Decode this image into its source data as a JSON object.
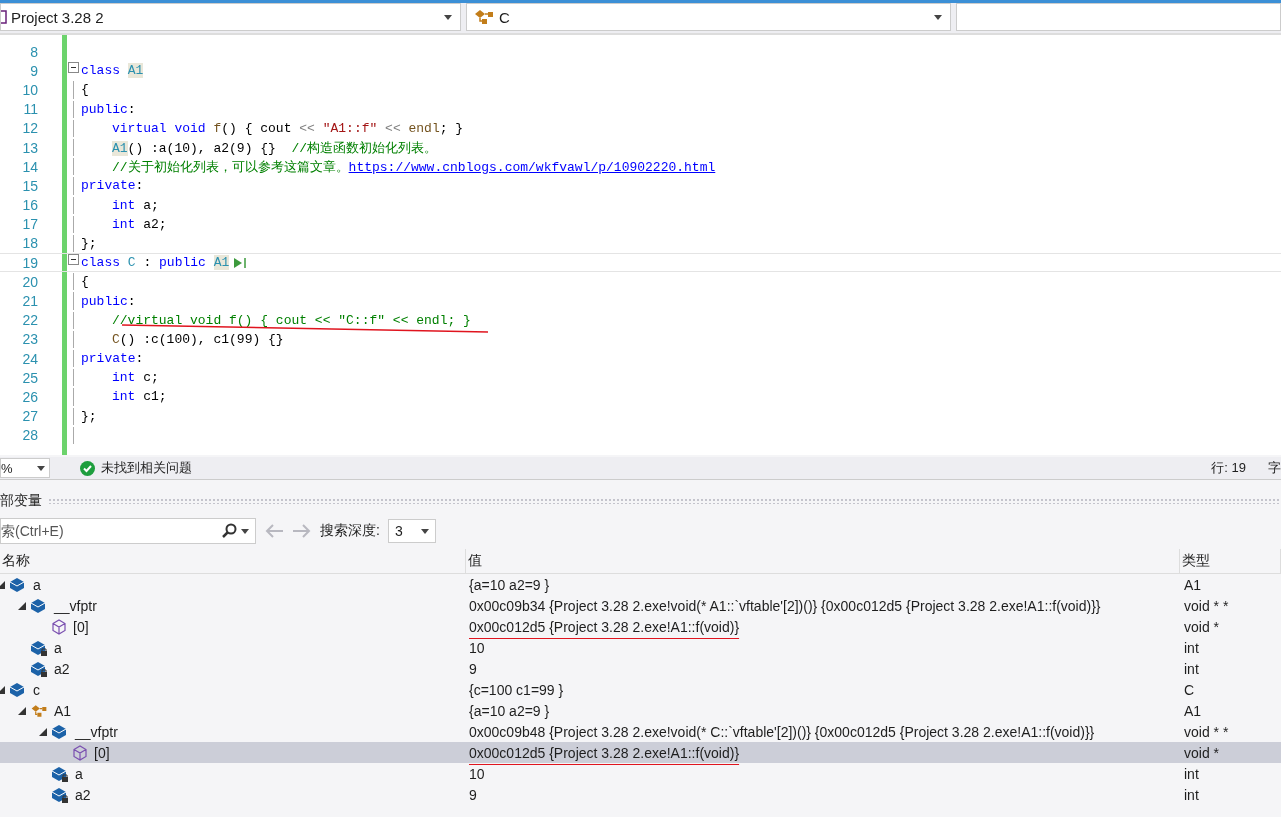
{
  "navbar": {
    "project": "Project 3.28 2",
    "scope": "C"
  },
  "code": [
    {
      "number": "8"
    },
    {
      "number": "9",
      "fold": true,
      "tokens": [
        {
          "kind": "kw",
          "text": "class "
        },
        {
          "kind": "ref",
          "text": "A1"
        }
      ]
    },
    {
      "number": "10",
      "tokens": [
        {
          "kind": "plain",
          "text": "{"
        }
      ]
    },
    {
      "number": "11",
      "tokens": [
        {
          "kind": "kw",
          "text": "public"
        },
        {
          "kind": "plain",
          "text": ":"
        }
      ]
    },
    {
      "number": "12",
      "indented": true,
      "tokens": [
        {
          "kind": "kw",
          "text": "virtual "
        },
        {
          "kind": "kw",
          "text": "void "
        },
        {
          "kind": "fn",
          "text": "f"
        },
        {
          "kind": "plain",
          "text": "() { cout "
        },
        {
          "kind": "op",
          "text": "<< "
        },
        {
          "kind": "str",
          "text": "\"A1::f\" "
        },
        {
          "kind": "op",
          "text": "<< "
        },
        {
          "kind": "fn",
          "text": "endl"
        },
        {
          "kind": "plain",
          "text": "; }"
        }
      ]
    },
    {
      "number": "13",
      "indented": true,
      "tokens": [
        {
          "kind": "ref",
          "text": "A1"
        },
        {
          "kind": "plain",
          "text": "() :a(10), a2(9) {}  "
        },
        {
          "kind": "comment",
          "text": "//构造函数初始化列表。"
        }
      ]
    },
    {
      "number": "14",
      "indented": true,
      "tokens": [
        {
          "kind": "comment",
          "text": "//关于初始化列表，可以参考这篇文章。"
        },
        {
          "kind": "link",
          "text": "https://www.cnblogs.com/wkfvawl/p/10902220.html"
        }
      ]
    },
    {
      "number": "15",
      "tokens": [
        {
          "kind": "kw",
          "text": "private"
        },
        {
          "kind": "plain",
          "text": ":"
        }
      ]
    },
    {
      "number": "16",
      "indented": true,
      "tokens": [
        {
          "kind": "kw",
          "text": "int"
        },
        {
          "kind": "plain",
          "text": " a;"
        }
      ]
    },
    {
      "number": "17",
      "indented": true,
      "tokens": [
        {
          "kind": "kw",
          "text": "int"
        },
        {
          "kind": "plain",
          "text": " a2;"
        }
      ]
    },
    {
      "number": "18",
      "tokens": [
        {
          "kind": "plain",
          "text": "};"
        }
      ]
    },
    {
      "number": "19",
      "fold": true,
      "current": true,
      "tokens": [
        {
          "kind": "kw",
          "text": "class "
        },
        {
          "kind": "type",
          "text": "C"
        },
        {
          "kind": "plain",
          "text": " : "
        },
        {
          "kind": "kw",
          "text": "public "
        },
        {
          "kind": "ref",
          "text": "A1"
        }
      ]
    },
    {
      "number": "20",
      "tokens": [
        {
          "kind": "plain",
          "text": "{"
        }
      ]
    },
    {
      "number": "21",
      "tokens": [
        {
          "kind": "kw",
          "text": "public"
        },
        {
          "kind": "plain",
          "text": ":"
        }
      ]
    },
    {
      "number": "22",
      "indented": true,
      "underlined": true,
      "tokens": [
        {
          "kind": "comment",
          "text": "//virtual void f() { cout << \"C::f\" << endl; }"
        }
      ]
    },
    {
      "number": "23",
      "indented": true,
      "tokens": [
        {
          "kind": "fn",
          "text": "C"
        },
        {
          "kind": "plain",
          "text": "() :c(100), c1(99) {}"
        }
      ]
    },
    {
      "number": "24",
      "tokens": [
        {
          "kind": "kw",
          "text": "private"
        },
        {
          "kind": "plain",
          "text": ":"
        }
      ]
    },
    {
      "number": "25",
      "indented": true,
      "tokens": [
        {
          "kind": "kw",
          "text": "int"
        },
        {
          "kind": "plain",
          "text": " c;"
        }
      ]
    },
    {
      "number": "26",
      "indented": true,
      "tokens": [
        {
          "kind": "kw",
          "text": "int"
        },
        {
          "kind": "plain",
          "text": " c1;"
        }
      ]
    },
    {
      "number": "27",
      "tokens": [
        {
          "kind": "plain",
          "text": "};"
        }
      ]
    },
    {
      "number": "28"
    }
  ],
  "status_bar": {
    "zoom": "%",
    "message": "未找到相关问题",
    "line": "行: 19",
    "column": "字"
  },
  "locals": {
    "title": "部变量",
    "search": {
      "placeholder": "索(Ctrl+E)"
    },
    "depth_label": "搜索深度:",
    "depth": "3",
    "columns": [
      "名称",
      "值",
      "类型"
    ],
    "rows": [
      {
        "name": "a",
        "value": "{a=10 a2=9 }",
        "type": "A1",
        "kind": "object",
        "expanded": true,
        "selected": false,
        "underlined": false,
        "children": [
          {
            "name": "__vfptr",
            "value": "0x00c09b34 {Project 3.28 2.exe!void(* A1::`vftable'[2])()} {0x00c012d5 {Project 3.28 2.exe!A1::f(void)}}",
            "type": "void * *",
            "kind": "object",
            "expanded": true,
            "selected": false,
            "underlined": false,
            "children": [
              {
                "name": "[0]",
                "value": "0x00c012d5 {Project 3.28 2.exe!A1::f(void)}",
                "type": "void *",
                "kind": "method",
                "selected": false,
                "underlined": true
              }
            ]
          },
          {
            "name": "a",
            "value": "10",
            "type": "int",
            "kind": "private",
            "selected": false,
            "underlined": false
          },
          {
            "name": "a2",
            "value": "9",
            "type": "int",
            "kind": "private",
            "selected": false,
            "underlined": false
          }
        ]
      },
      {
        "name": "c",
        "value": "{c=100 c1=99 }",
        "type": "C",
        "kind": "object",
        "expanded": true,
        "selected": false,
        "underlined": false,
        "children": [
          {
            "name": "A1",
            "value": "{a=10 a2=9 }",
            "type": "A1",
            "kind": "base",
            "expanded": true,
            "selected": false,
            "underlined": false,
            "children": [
              {
                "name": "__vfptr",
                "value": "0x00c09b48 {Project 3.28 2.exe!void(* C::`vftable'[2])()} {0x00c012d5 {Project 3.28 2.exe!A1::f(void)}}",
                "type": "void * *",
                "kind": "object",
                "expanded": true,
                "selected": false,
                "underlined": false,
                "children": [
                  {
                    "name": "[0]",
                    "value": "0x00c012d5 {Project 3.28 2.exe!A1::f(void)}",
                    "type": "void *",
                    "kind": "method",
                    "selected": true,
                    "underlined": true
                  }
                ]
              },
              {
                "name": "a",
                "value": "10",
                "type": "int",
                "kind": "private",
                "selected": false,
                "underlined": false
              },
              {
                "name": "a2",
                "value": "9",
                "type": "int",
                "kind": "private",
                "selected": false,
                "underlined": false
              }
            ]
          }
        ]
      }
    ]
  }
}
